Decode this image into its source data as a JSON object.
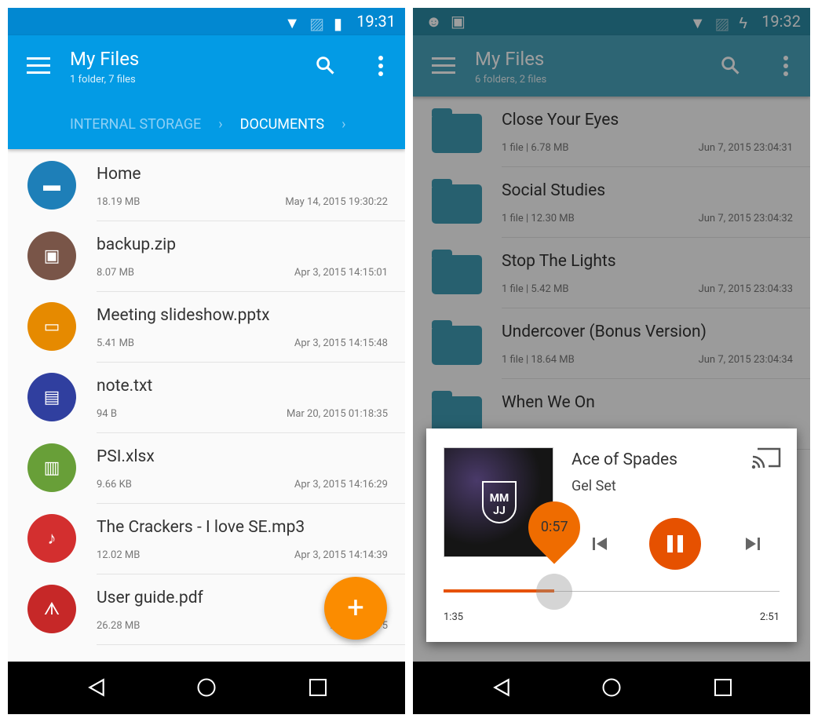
{
  "left": {
    "status": {
      "time": "19:31",
      "icons": [
        "wifi-icon",
        "no-sim-icon",
        "battery-icon"
      ]
    },
    "toolbar": {
      "title": "My Files",
      "subtitle": "1 folder, 7 files",
      "color": "#039be5"
    },
    "breadcrumbs": [
      "INTERNAL STORAGE",
      "DOCUMENTS"
    ],
    "items": [
      {
        "name": "Home",
        "size": "18.19 MB",
        "date": "May 14, 2015 19:30:22",
        "icon": "folder-icon",
        "color": "#1e7fb8"
      },
      {
        "name": "backup.zip",
        "size": "8.07 MB",
        "date": "Apr 3, 2015 14:15:01",
        "icon": "archive-icon",
        "color": "#795548"
      },
      {
        "name": "Meeting slideshow.pptx",
        "size": "5.41 MB",
        "date": "Apr 3, 2015 14:15:48",
        "icon": "slideshow-icon",
        "color": "#e68a00"
      },
      {
        "name": "note.txt",
        "size": "94 B",
        "date": "Mar 20, 2015 01:18:35",
        "icon": "document-icon",
        "color": "#303f9f"
      },
      {
        "name": "PSI.xlsx",
        "size": "9.66 KB",
        "date": "Apr 3, 2015 14:16:29",
        "icon": "chart-icon",
        "color": "#689f38"
      },
      {
        "name": "The Crackers - I love SE.mp3",
        "size": "12.02 MB",
        "date": "Apr 3, 2015 14:14:39",
        "icon": "music-icon",
        "color": "#d32f2f"
      },
      {
        "name": "User guide.pdf",
        "size": "26.28 MB",
        "date": "Apr 19, 2015",
        "icon": "pdf-icon",
        "color": "#c62828"
      }
    ],
    "fab": "+"
  },
  "right": {
    "status": {
      "time": "19:32",
      "icons": [
        "android-icon",
        "media-icon",
        "wifi-icon",
        "no-sim-icon",
        "battery-charging-icon"
      ]
    },
    "toolbar": {
      "title": "My Files",
      "subtitle": "6 folders, 2 files",
      "color": "#4aa3bb"
    },
    "items": [
      {
        "name": "Close Your Eyes",
        "meta": "1 file  |  6.78 MB",
        "date": "Jun 7, 2015 23:04:31"
      },
      {
        "name": "Social Studies",
        "meta": "1 file  |  12.30 MB",
        "date": "Jun 7, 2015 23:04:32"
      },
      {
        "name": "Stop The Lights",
        "meta": "1 file  |  5.42 MB",
        "date": "Jun 7, 2015 23:04:33"
      },
      {
        "name": "Undercover (Bonus Version)",
        "meta": "1 file  |  18.64 MB",
        "date": "Jun 7, 2015 23:04:34"
      },
      {
        "name": "When We On",
        "meta": "",
        "date": ""
      }
    ],
    "player": {
      "song": "Ace of Spades",
      "artist": "Gel Set",
      "album_logo": "MMJJ",
      "elapsed": "1:35",
      "total": "2:51",
      "seek_label": "0:57",
      "progress": 0.33,
      "accent": "#e65100"
    }
  }
}
